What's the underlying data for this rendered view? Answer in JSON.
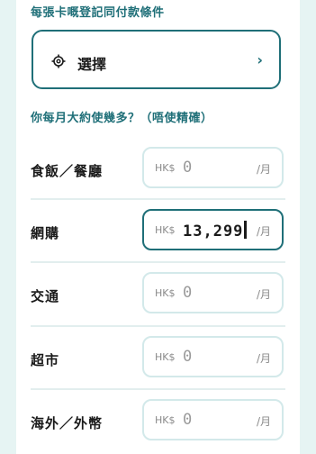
{
  "section_title": "每張卡嘅登記同付款條件",
  "select_button": {
    "label": "選擇",
    "chevron": "›",
    "icon": "gear-icon"
  },
  "question": "你每月大約使幾多？（唔使精確）",
  "currency_prefix": "HK$",
  "unit_suffix": "/月",
  "categories": [
    {
      "label": "食飯／餐廳",
      "value": "0",
      "active": false
    },
    {
      "label": "網購",
      "value": "13,299",
      "active": true
    },
    {
      "label": "交通",
      "value": "0",
      "active": false
    },
    {
      "label": "超市",
      "value": "0",
      "active": false
    },
    {
      "label": "海外／外幣",
      "value": "0",
      "active": false
    }
  ],
  "colors": {
    "accent": "#1f6f78",
    "page_bg": "#e6f4f3",
    "field_border": "#d3e9ea"
  }
}
